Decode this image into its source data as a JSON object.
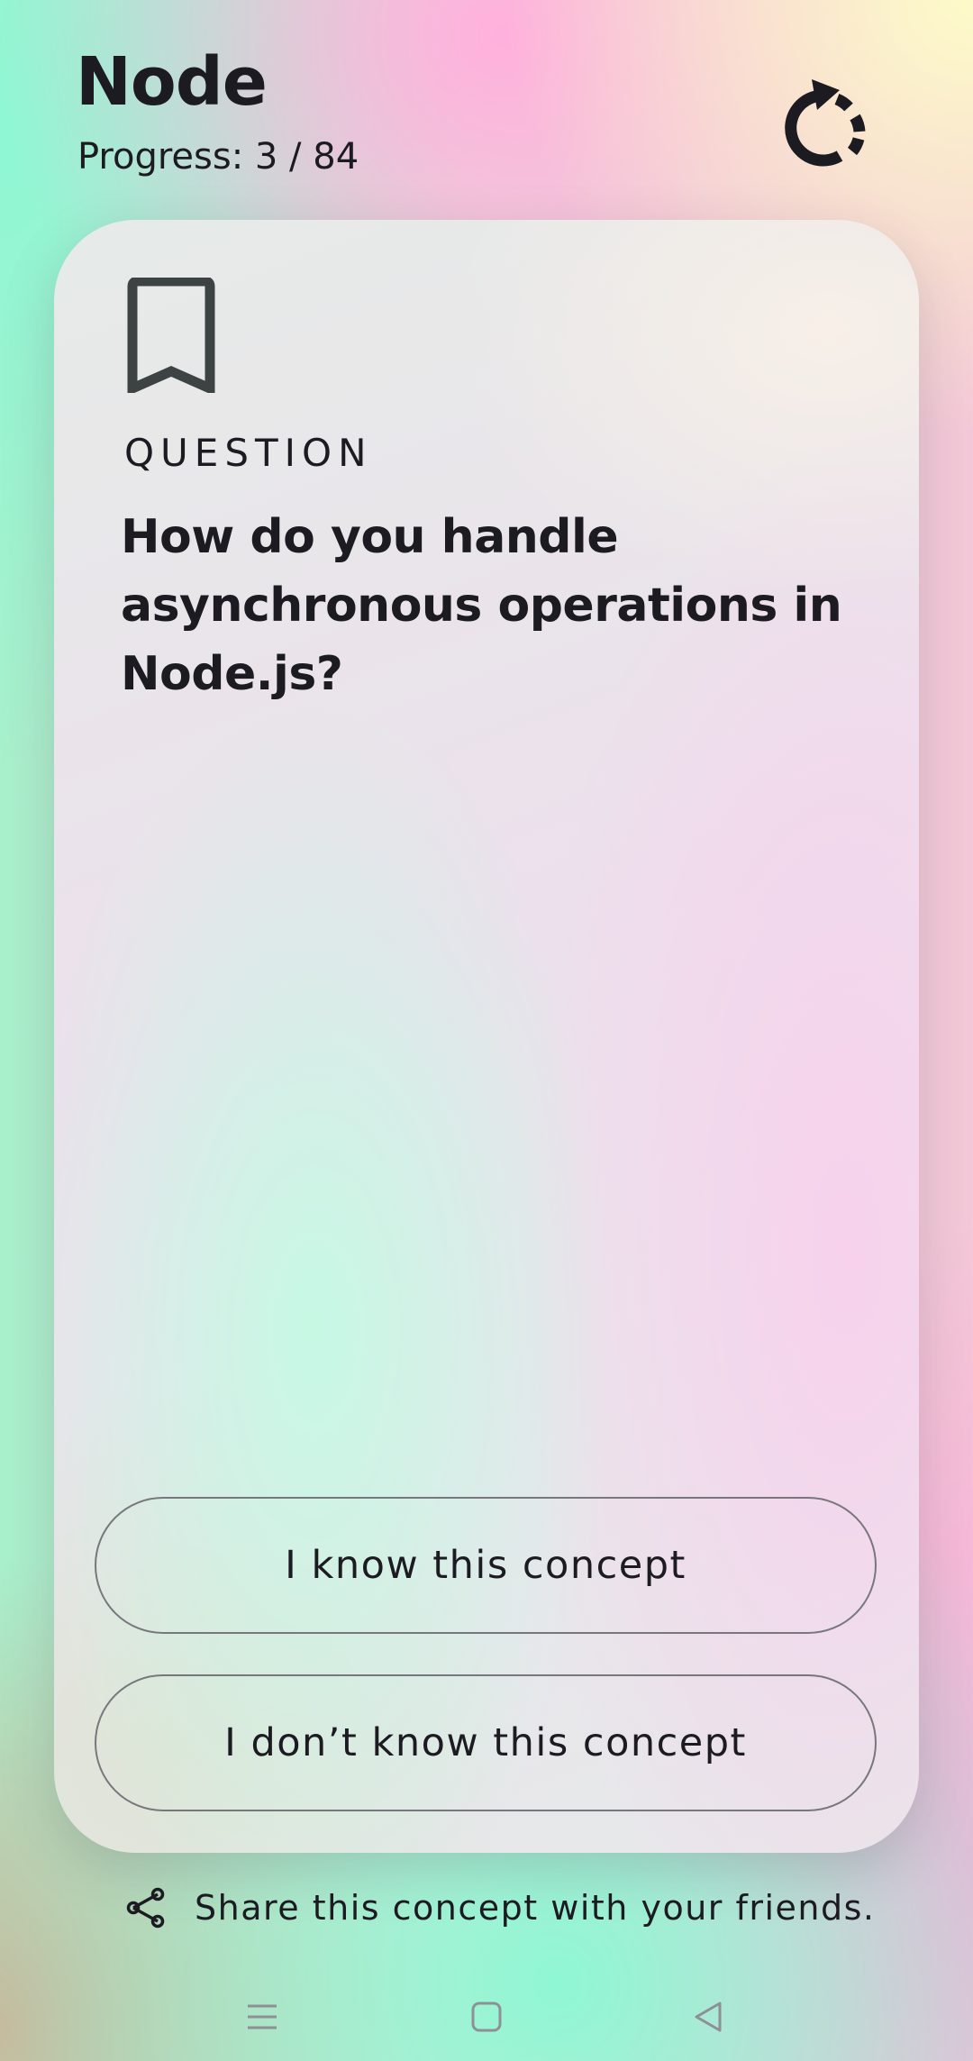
{
  "header": {
    "title": "Node",
    "progress_label": "Progress:",
    "progress_current": 3,
    "progress_total": 84,
    "progress_text": "Progress: 3 / 84"
  },
  "card": {
    "section_label": "QUESTION",
    "question": "How do you handle asynchronous operations in Node.js?",
    "know_label": "I know this concept",
    "dont_know_label": "I don’t know this concept"
  },
  "share": {
    "label": "Share this concept with your friends."
  },
  "icons": {
    "reset": "reset-icon",
    "bookmark": "bookmark-icon",
    "share": "share-icon",
    "nav_menu": "menu-icon",
    "nav_home": "home-icon",
    "nav_back": "back-icon"
  },
  "colors": {
    "text": "#1c1b22",
    "bookmark": "#3c4342",
    "button_border": "#77777d",
    "nav_icon": "#8f8f96"
  }
}
